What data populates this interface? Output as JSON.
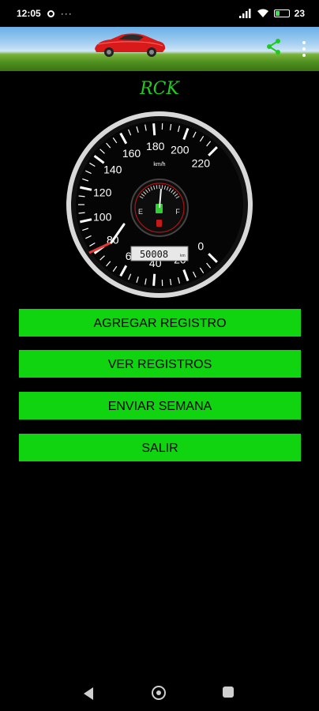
{
  "status_bar": {
    "time": "12:05",
    "dots": "···",
    "battery": "23"
  },
  "app": {
    "title": "RCK"
  },
  "speedometer": {
    "labels": [
      "0",
      "20",
      "40",
      "60",
      "80",
      "100",
      "120",
      "140",
      "160",
      "180",
      "200",
      "220"
    ],
    "unit": "km/h",
    "fuel_empty": "E",
    "fuel_full": "F",
    "odometer": "50008",
    "odometer_unit": "km"
  },
  "buttons": {
    "add": "AGREGAR REGISTRO",
    "view": "VER REGISTROS",
    "send": "ENVIAR SEMANA",
    "exit": "SALIR"
  },
  "colors": {
    "accent": "#0fd40f",
    "title": "#1ecb1e"
  }
}
